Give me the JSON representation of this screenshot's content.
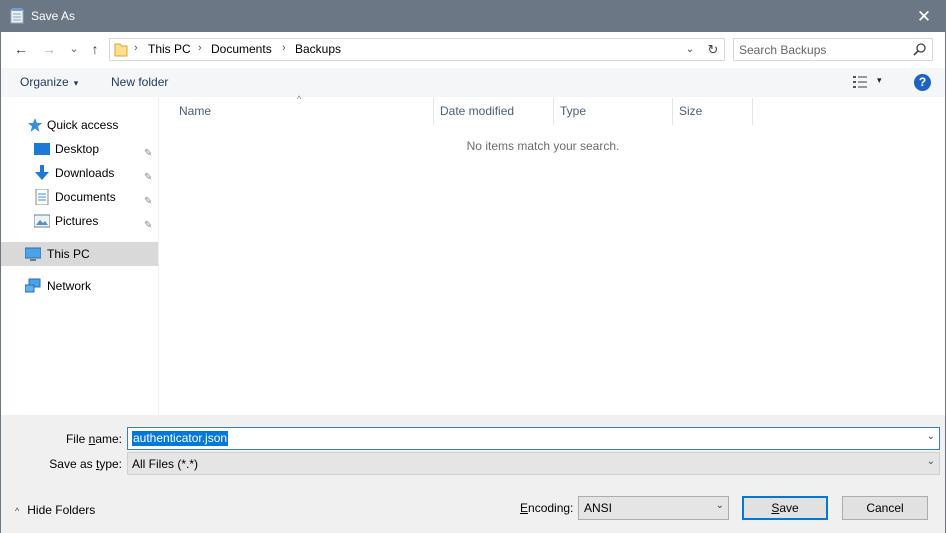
{
  "window": {
    "title": "Save As",
    "close_glyph": "✕",
    "title_icon": "notepad-icon"
  },
  "address": {
    "crumbs": [
      "This PC",
      "Documents",
      "Backups"
    ],
    "separator": "›",
    "back_glyph": "←",
    "forward_glyph": "→",
    "recent_glyph": "⌄",
    "up_glyph": "↑",
    "dropdown_glyph": "⌄",
    "refresh_glyph": "↻"
  },
  "search": {
    "placeholder": "Search Backups"
  },
  "toolbar": {
    "organize_label": "Organize",
    "new_folder_label": "New folder",
    "caret": "▾",
    "help_label": "?"
  },
  "nav": {
    "quick_access": "Quick access",
    "items": [
      {
        "label": "Desktop",
        "icon": "desktop-icon",
        "pinned": true
      },
      {
        "label": "Downloads",
        "icon": "downloads-icon",
        "pinned": true
      },
      {
        "label": "Documents",
        "icon": "documents-icon",
        "pinned": true
      },
      {
        "label": "Pictures",
        "icon": "pictures-icon",
        "pinned": true
      }
    ],
    "this_pc": "This PC",
    "network": "Network",
    "pin_glyph": "📌"
  },
  "columns": {
    "name": "Name",
    "date_modified": "Date modified",
    "type": "Type",
    "size": "Size",
    "sort_glyph": "^"
  },
  "empty_message": "No items match your search.",
  "form": {
    "file_name_label_pre": "File ",
    "file_name_label_u": "n",
    "file_name_label_post": "ame:",
    "file_name_value": "authenticator.json",
    "save_type_label_pre": "Save as ",
    "save_type_label_u": "t",
    "save_type_label_post": "ype:",
    "save_type_value": "All Files  (*.*)",
    "caret": "⌄"
  },
  "footer": {
    "hide_folders": "Hide Folders",
    "encoding_label_pre": "",
    "encoding_label_u": "E",
    "encoding_label_post": "ncoding:",
    "encoding_value": "ANSI",
    "save_label_u": "S",
    "save_label_post": "ave",
    "cancel_label": "Cancel",
    "hide_caret": "^"
  },
  "colors": {
    "titlebar": "#6b7785",
    "accent": "#0078d7",
    "help": "#1f63c0"
  }
}
